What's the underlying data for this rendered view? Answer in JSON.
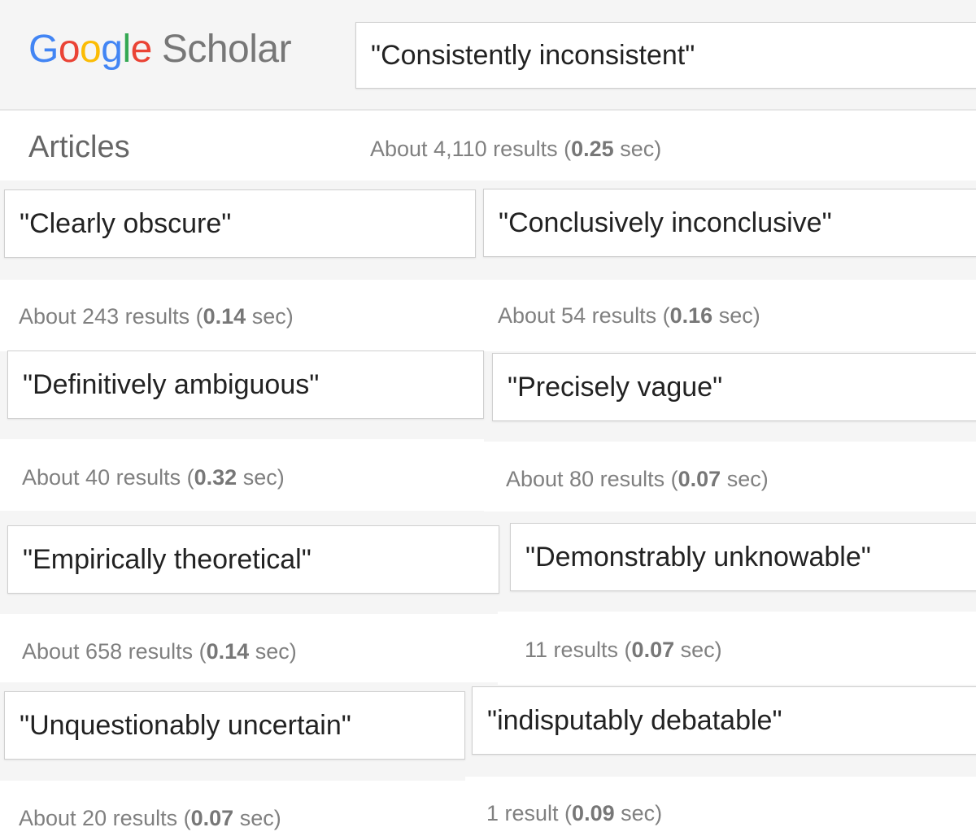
{
  "logo": {
    "google_letters": [
      {
        "char": "G",
        "color": "#4285f4"
      },
      {
        "char": "o",
        "color": "#ea4335"
      },
      {
        "char": "o",
        "color": "#fbbc05"
      },
      {
        "char": "g",
        "color": "#4285f4"
      },
      {
        "char": "l",
        "color": "#34a853"
      },
      {
        "char": "e",
        "color": "#ea4335"
      }
    ],
    "product": "Scholar",
    "product_color": "#777777"
  },
  "header": {
    "query": "\"Consistently inconsistent\"",
    "section_label": "Articles",
    "stats": {
      "prefix": "About 4,110 results (",
      "time": "0.25",
      "suffix": " sec)"
    }
  },
  "searches": [
    {
      "query": "\"Clearly obscure\"",
      "stats": {
        "prefix": "About 243 results (",
        "time": "0.14",
        "suffix": " sec)"
      }
    },
    {
      "query": "\"Conclusively inconclusive\"",
      "stats": {
        "prefix": "About 54 results (",
        "time": "0.16",
        "suffix": " sec)"
      }
    },
    {
      "query": "\"Definitively ambiguous\"",
      "stats": {
        "prefix": "About 40 results (",
        "time": "0.32",
        "suffix": " sec)"
      }
    },
    {
      "query": "\"Precisely vague\"",
      "stats": {
        "prefix": "About 80 results (",
        "time": "0.07",
        "suffix": " sec)"
      }
    },
    {
      "query": "\"Empirically theoretical\"",
      "stats": {
        "prefix": "About 658 results (",
        "time": "0.14",
        "suffix": " sec)"
      }
    },
    {
      "query": "\"Demonstrably unknowable\"",
      "stats": {
        "prefix": "11 results (",
        "time": "0.07",
        "suffix": " sec)"
      }
    },
    {
      "query": "\"Unquestionably uncertain\"",
      "stats": {
        "prefix": "About 20 results (",
        "time": "0.07",
        "suffix": " sec)"
      }
    },
    {
      "query": "\"indisputably debatable\"",
      "stats": {
        "prefix": "1 result (",
        "time": "0.09",
        "suffix": " sec)"
      }
    }
  ]
}
